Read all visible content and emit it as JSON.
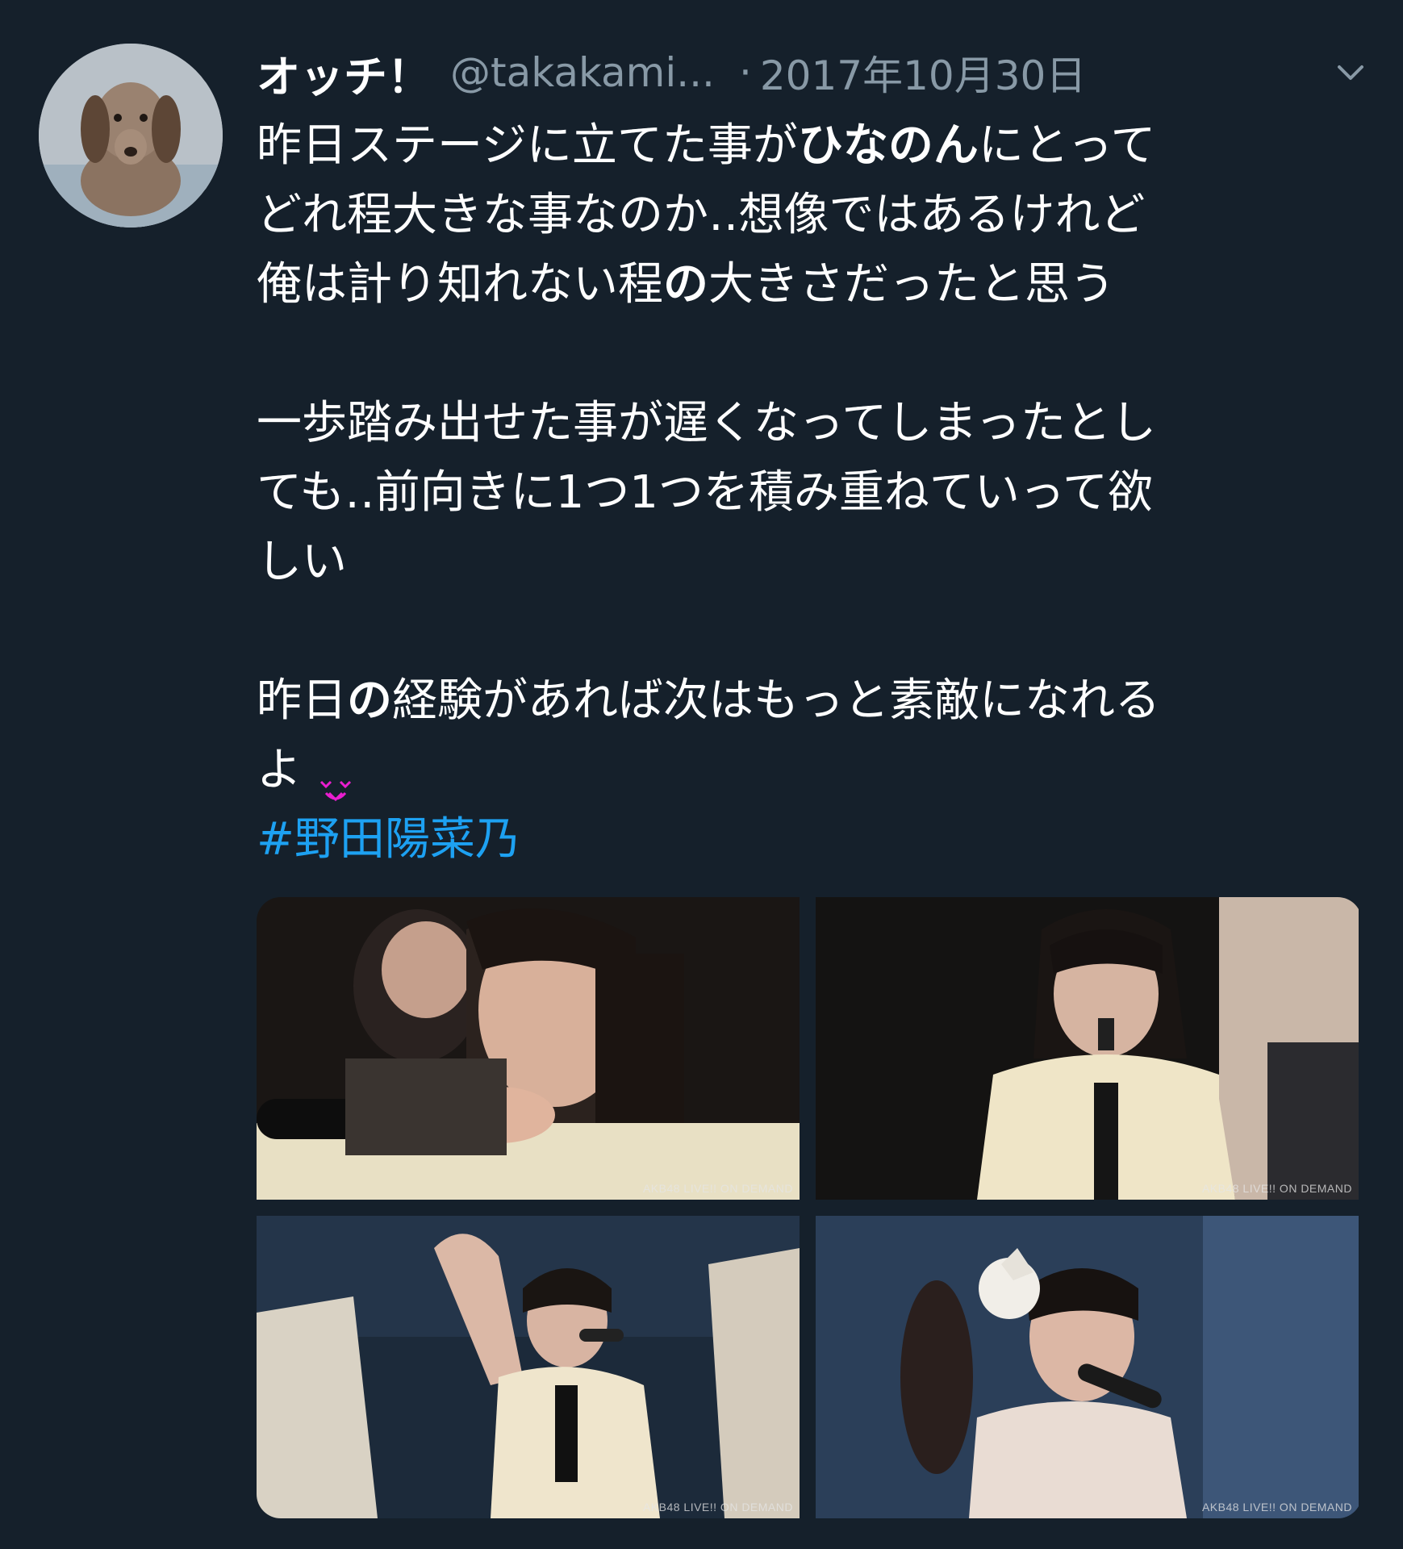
{
  "tweet": {
    "author": {
      "display_name": "オッチ！",
      "handle": "@takakami...",
      "avatar_icon": "dachshund-avatar"
    },
    "separator": "·",
    "timestamp": "2017年10月30日",
    "menu_icon": "chevron-down-icon",
    "text_lines": [
      "昨日ステージに立てた事が",
      "ひなのん",
      "にとって",
      "どれ程大きな事なのか‥想像ではあるけれど",
      "俺は計り知れない程",
      "の",
      "大きさだったと思う",
      "一歩踏み出せた事が遅くなってしまったとし",
      "ても‥前向きに1つ1つを積み重ねていって欲",
      "しい",
      "昨日",
      "の",
      "経験があれば次はもっと素敵になれる",
      "よ"
    ],
    "emoji": "heart-face-emoji",
    "hashtag": "#野田陽菜乃"
  },
  "media": [
    {
      "caption": "AKB48 LIVE!! ON DEMAND",
      "scene": "close-up-with-microphone"
    },
    {
      "caption": "AKB48 LIVE!! ON DEMAND",
      "scene": "smiling-with-microphone"
    },
    {
      "caption": "AKB48 LIVE!! ON DEMAND",
      "scene": "waving-on-stage"
    },
    {
      "caption": "AKB48 LIVE!! ON DEMAND",
      "scene": "singing-with-microphone"
    }
  ],
  "colors": {
    "background": "#15202b",
    "text": "#ffffff",
    "muted": "#8899a6",
    "link": "#1da1f2",
    "emoji": "#e91ecf"
  }
}
